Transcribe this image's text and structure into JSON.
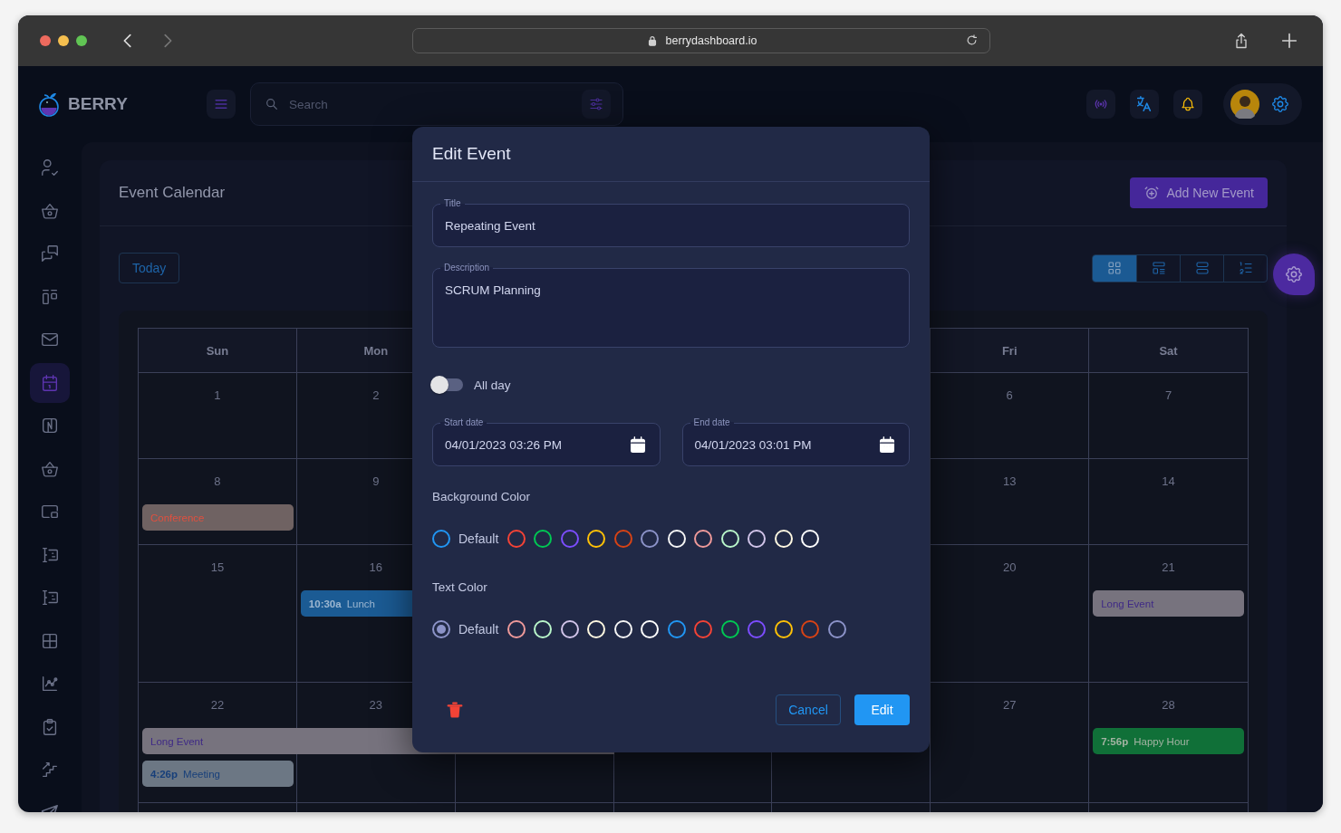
{
  "browser": {
    "url": "berrydashboard.io"
  },
  "header": {
    "logo": "BERRY",
    "search": {
      "placeholder": "Search"
    }
  },
  "sidebar": {
    "items": [
      {
        "selected": false
      },
      {
        "selected": false
      },
      {
        "selected": false
      },
      {
        "selected": false
      },
      {
        "selected": false
      },
      {
        "selected": true
      },
      {
        "selected": false
      },
      {
        "selected": false
      },
      {
        "selected": false
      },
      {
        "selected": false
      },
      {
        "selected": false
      },
      {
        "selected": false
      },
      {
        "selected": false
      },
      {
        "selected": false
      },
      {
        "selected": false
      },
      {
        "selected": false
      }
    ]
  },
  "page": {
    "title": "Event Calendar",
    "add_button": "Add New Event",
    "today_button": "Today",
    "views": [
      {
        "selected": true
      },
      {
        "selected": false
      },
      {
        "selected": false
      },
      {
        "selected": false
      }
    ]
  },
  "calendar": {
    "weekdays_left": [
      "Sun",
      "Mon"
    ],
    "weekdays_right": [
      "Fri",
      "Sat"
    ],
    "weeks": [
      {
        "cells": [
          {
            "day": "1"
          },
          {
            "day": "2"
          },
          {},
          {},
          {},
          {
            "day": "6"
          },
          {
            "day": "7"
          }
        ]
      },
      {
        "cells": [
          {
            "day": "8",
            "events": [
              {
                "title": "Conference",
                "continues": false,
                "color": "#6f6262",
                "ink": {
                  "color": "#e0503f"
                }
              }
            ]
          },
          {
            "day": "9"
          },
          {},
          {},
          {},
          {
            "day": "13"
          },
          {
            "day": "14"
          }
        ]
      },
      {
        "cells": [
          {
            "day": "15"
          },
          {
            "day": "16",
            "events": [
              {
                "time": "10:30a",
                "title": "Lunch",
                "continues": true,
                "color": "#1b5b94",
                "ink": {
                  "color": "#9cb6d0"
                }
              }
            ]
          },
          {},
          {},
          {},
          {
            "day": "20"
          },
          {
            "day": "21",
            "events": [
              {
                "title": "Long Event",
                "continues": false,
                "color": "#77737e",
                "ink": {
                  "color": "#3f2a86"
                }
              }
            ]
          }
        ]
      },
      {
        "cells": [
          {
            "day": "22",
            "events": [
              {
                "title": "Long Event",
                "continues": true,
                "color": "#77737e",
                "ink": {
                  "color": "#3f2a86"
                }
              },
              {
                "time": "4:26p",
                "title": "Meeting",
                "continues": false,
                "color": "#6c7784",
                "ink": {
                  "color": "#173f7a"
                }
              }
            ]
          },
          {
            "day": "23"
          },
          {},
          {},
          {},
          {
            "day": "27"
          },
          {
            "day": "28",
            "events": [
              {
                "time": "7:56p",
                "title": "Happy Hour",
                "continues": false,
                "color": "#107038",
                "ink": {
                  "color": "#a3b3a3"
                }
              }
            ]
          }
        ]
      },
      {
        "cells": [
          {},
          {},
          {},
          {},
          {},
          {},
          {}
        ]
      }
    ]
  },
  "dialog": {
    "title": "Edit Event",
    "title_field": {
      "label": "Title",
      "value": "Repeating Event"
    },
    "description_field": {
      "label": "Description",
      "value": "SCRUM Planning"
    },
    "all_day": {
      "label": "All day",
      "on": false
    },
    "start_date": {
      "label": "Start date",
      "value": "04/01/2023 03:26 PM"
    },
    "end_date": {
      "label": "End date",
      "value": "04/01/2023 03:01 PM"
    },
    "background_color": {
      "label": "Background Color",
      "options": [
        {
          "label": "Default",
          "color": "#2196f3",
          "selected": false
        },
        {
          "color": "#f44336",
          "selected": false
        },
        {
          "color": "#00c853",
          "selected": false
        },
        {
          "color": "#7c4dff",
          "selected": false
        },
        {
          "color": "#ffc107",
          "selected": false
        },
        {
          "color": "#d84315",
          "selected": false
        },
        {
          "color": "#8c93c8",
          "selected": false
        },
        {
          "color": "#f5f5f5",
          "selected": false
        },
        {
          "color": "#ef9a9a",
          "selected": false
        },
        {
          "color": "#b9f6ca",
          "selected": false
        },
        {
          "color": "#d1c4e9",
          "selected": false
        },
        {
          "color": "#fff8e1",
          "selected": false
        },
        {
          "color": "#ffffff",
          "selected": false
        }
      ]
    },
    "text_color": {
      "label": "Text Color",
      "options": [
        {
          "label": "Default",
          "color": "#8c93c8",
          "selected": true
        },
        {
          "color": "#ef9a9a",
          "selected": false
        },
        {
          "color": "#b9f6ca",
          "selected": false
        },
        {
          "color": "#d1c4e9",
          "selected": false
        },
        {
          "color": "#fff8e1",
          "selected": false
        },
        {
          "color": "#f5f5f5",
          "selected": false
        },
        {
          "color": "#ffffff",
          "selected": false
        },
        {
          "color": "#2196f3",
          "selected": false
        },
        {
          "color": "#f44336",
          "selected": false
        },
        {
          "color": "#00c853",
          "selected": false
        },
        {
          "color": "#7c4dff",
          "selected": false
        },
        {
          "color": "#ffc107",
          "selected": false
        },
        {
          "color": "#d84315",
          "selected": false
        },
        {
          "color": "#8c93c9",
          "selected": false
        }
      ]
    },
    "cancel_button": "Cancel",
    "edit_button": "Edit"
  }
}
